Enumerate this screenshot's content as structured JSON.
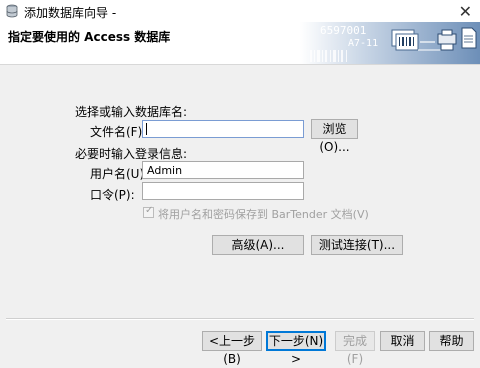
{
  "window": {
    "title": "添加数据库向导 -",
    "close_glyph": "✕"
  },
  "banner": {
    "title": "指定要使用的 Access 数据库",
    "art_texts": [
      "6597001",
      "A7-11"
    ]
  },
  "form": {
    "section1_label": "选择或输入数据库名:",
    "filename_label": "文件名(F):",
    "filename_value": "",
    "browse_label": "浏览(O)...",
    "section2_label": "必要时输入登录信息:",
    "username_label": "用户名(U):",
    "username_value": "Admin",
    "password_label": "口令(P):",
    "password_value": "",
    "save_checkbox_label": "将用户名和密码保存到 BarTender 文档(V)",
    "save_checkbox_checked": true,
    "advanced_label": "高级(A)...",
    "test_label": "测试连接(T)..."
  },
  "footer": {
    "back_label": "<上一步(B)",
    "next_label": "下一步(N) >",
    "finish_label": "完成(F)",
    "cancel_label": "取消",
    "help_label": "帮助"
  },
  "colors": {
    "focus_border": "#7a9cd3",
    "primary_border": "#0078d7",
    "disabled_text": "#a0a0a0"
  }
}
